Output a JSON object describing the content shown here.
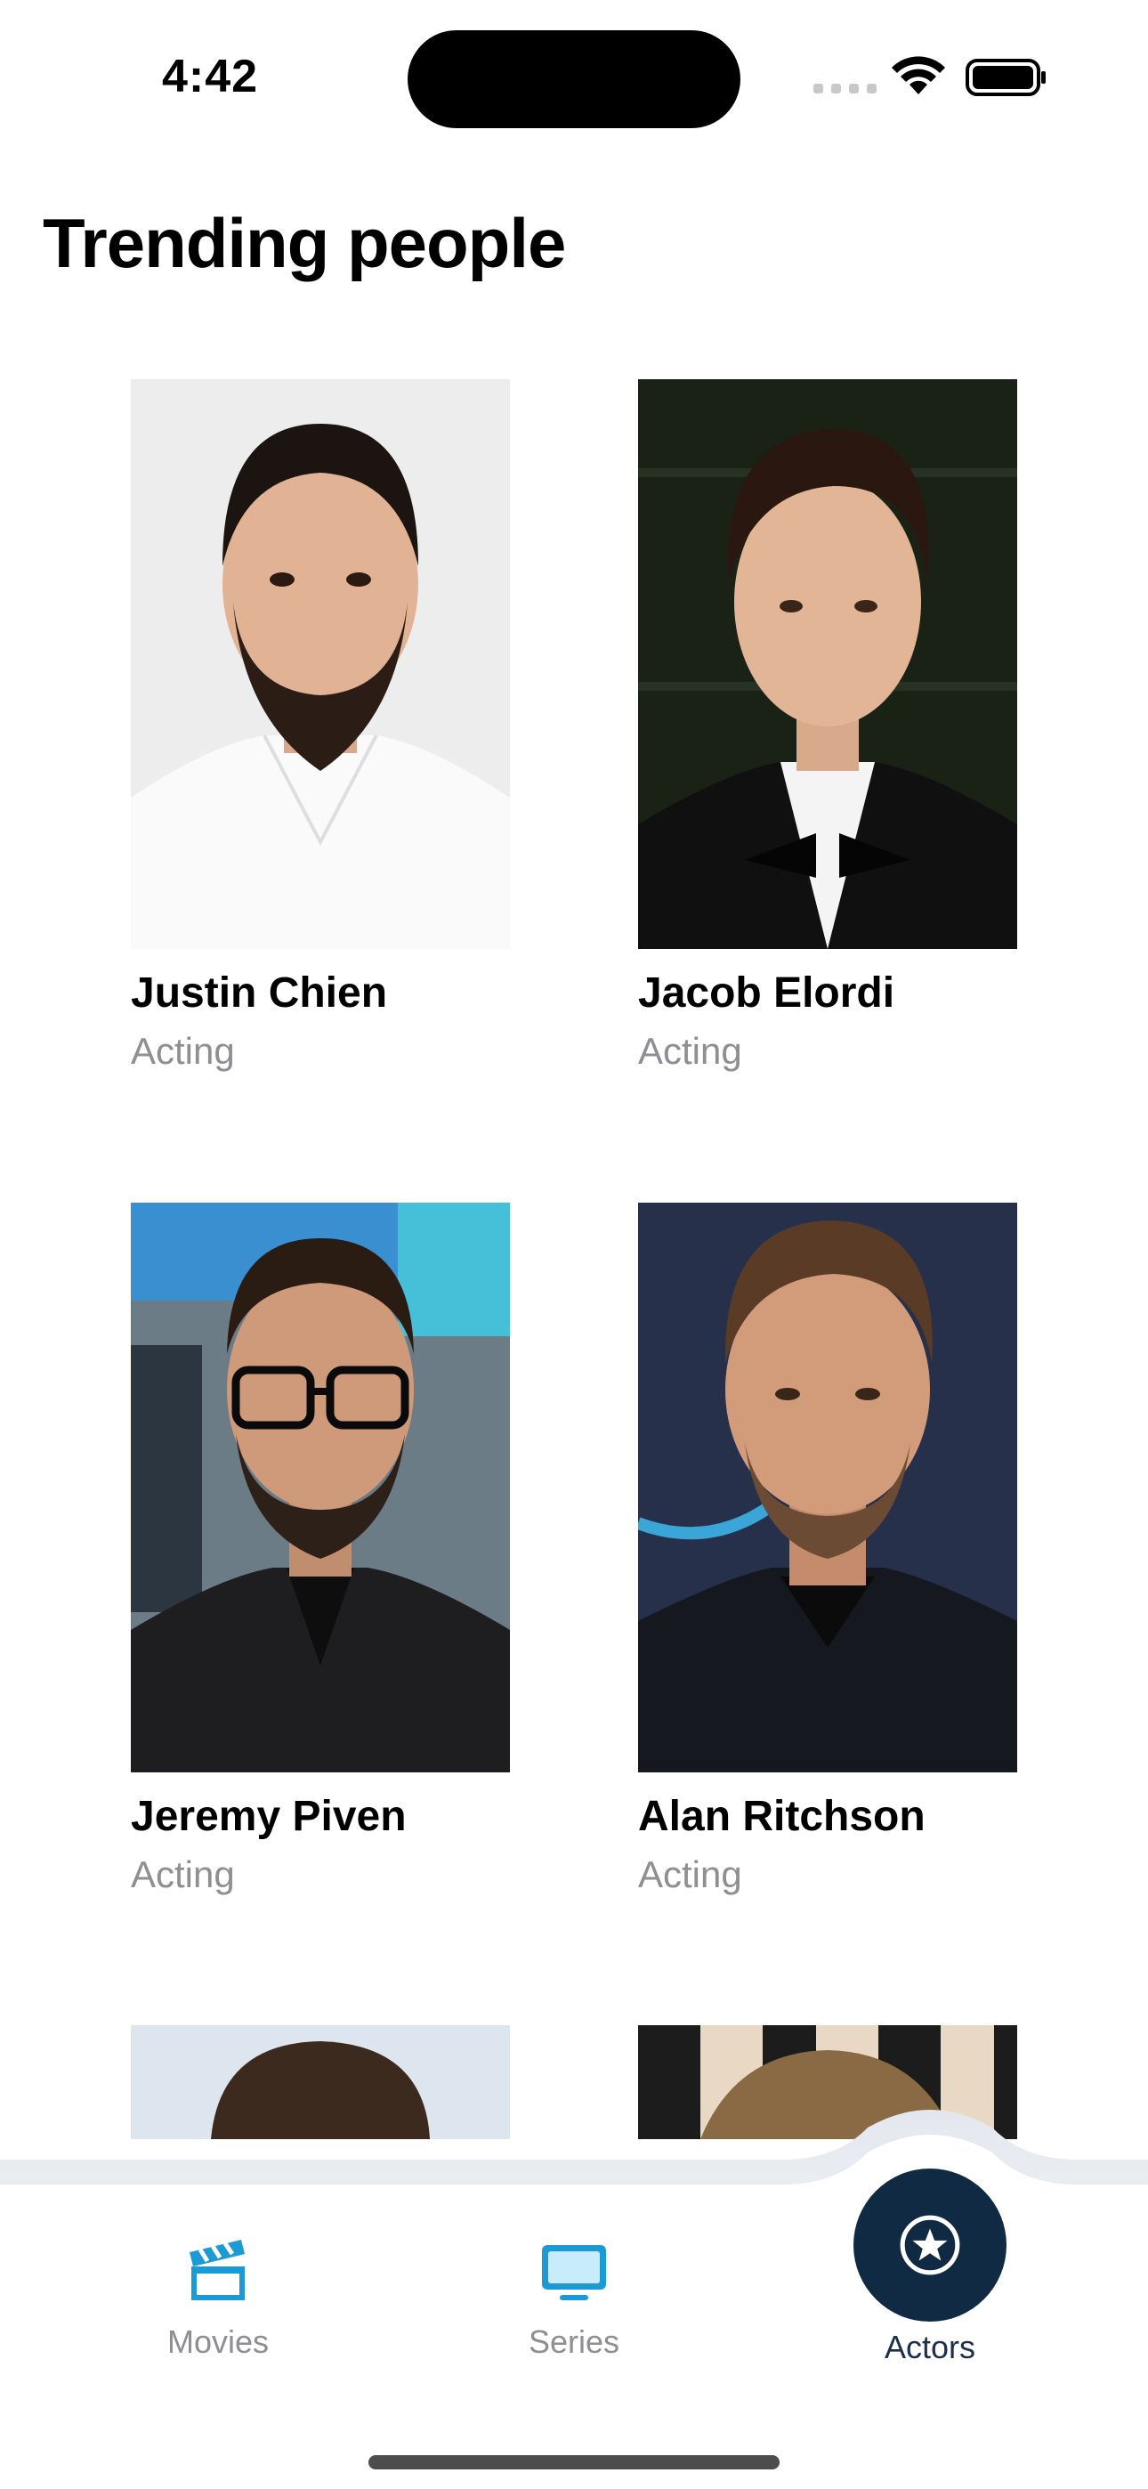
{
  "status": {
    "time": "4:42"
  },
  "page": {
    "title": "Trending people"
  },
  "people": [
    {
      "name": "Justin Chien",
      "department": "Acting"
    },
    {
      "name": "Jacob Elordi",
      "department": "Acting"
    },
    {
      "name": "Jeremy Piven",
      "department": "Acting"
    },
    {
      "name": "Alan Ritchson",
      "department": "Acting"
    }
  ],
  "tabs": [
    {
      "label": "Movies",
      "icon": "clapperboard-icon"
    },
    {
      "label": "Series",
      "icon": "tv-icon"
    },
    {
      "label": "Actors",
      "icon": "star-circle-icon",
      "active": true
    }
  ],
  "colors": {
    "accent": "#1c9ad6",
    "active_tab": "#112a43",
    "secondary_text": "#8e8e93"
  }
}
